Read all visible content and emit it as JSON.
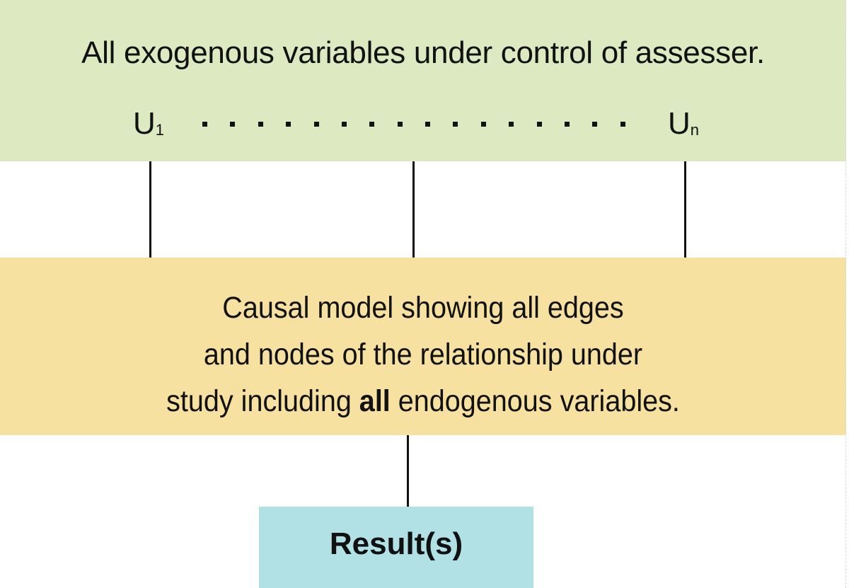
{
  "colors": {
    "exogenous_box": "#dce9c1",
    "endogenous_box": "#f6e1a1",
    "result_box": "#b1e0e5",
    "line": "#111111"
  },
  "exogenous": {
    "title": "All exogenous variables under control of assesser.",
    "u_first": "U",
    "u_first_sub": "1",
    "u_last": "U",
    "u_last_sub": "n",
    "dot_count": 16
  },
  "causal_model": {
    "line1": "Causal model showing all edges",
    "line2": "and nodes of the relationship under",
    "line3_pre": "study including ",
    "line3_bold": "all",
    "line3_post": " endogenous variables."
  },
  "result": {
    "label": "Result(s)"
  }
}
